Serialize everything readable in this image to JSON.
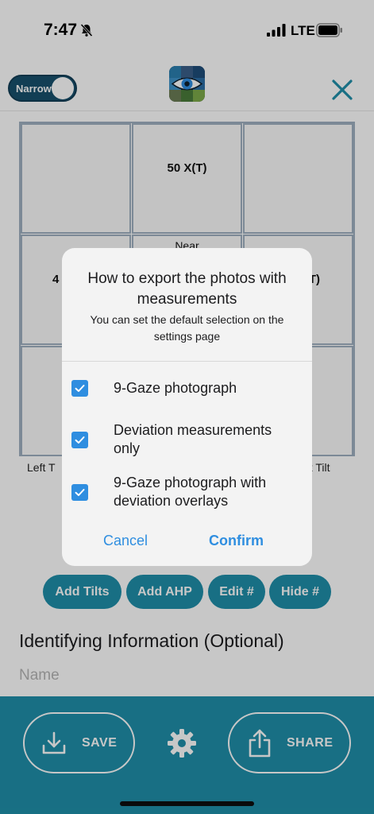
{
  "status_bar": {
    "time": "7:47",
    "network": "LTE"
  },
  "header": {
    "toggle_label": "Narrow"
  },
  "grid": {
    "cells": [
      {
        "main": "",
        "small": ""
      },
      {
        "main": "50 X(T)",
        "small": ""
      },
      {
        "main": "",
        "small": ""
      },
      {
        "main": "4",
        "small": ""
      },
      {
        "main": "",
        "small": "Near"
      },
      {
        "main": "T)",
        "small": ""
      },
      {
        "main": "",
        "small": ""
      },
      {
        "main": "",
        "small": ""
      },
      {
        "main": "",
        "small": ""
      }
    ],
    "left_tilt": "Left T",
    "right_tilt": "ht Tilt"
  },
  "actions": {
    "add_tilts": "Add Tilts",
    "add_ahp": "Add AHP",
    "edit": "Edit #",
    "hide": "Hide #"
  },
  "identifying": {
    "title": "Identifying Information (Optional)",
    "name_placeholder": "Name"
  },
  "bottom": {
    "save": "SAVE",
    "share": "SHARE"
  },
  "dialog": {
    "title": "How to export the photos with measurements",
    "subtitle": "You can set the default selection on the settings page",
    "options": [
      {
        "label": "9-Gaze photograph",
        "checked": true
      },
      {
        "label": "Deviation measurements only",
        "checked": true
      },
      {
        "label": "9-Gaze photograph with deviation overlays",
        "checked": true
      }
    ],
    "cancel": "Cancel",
    "confirm": "Confirm"
  },
  "colors": {
    "accent": "#1f8fa9",
    "toggle": "#18506c",
    "link_blue": "#2f8ee0"
  }
}
